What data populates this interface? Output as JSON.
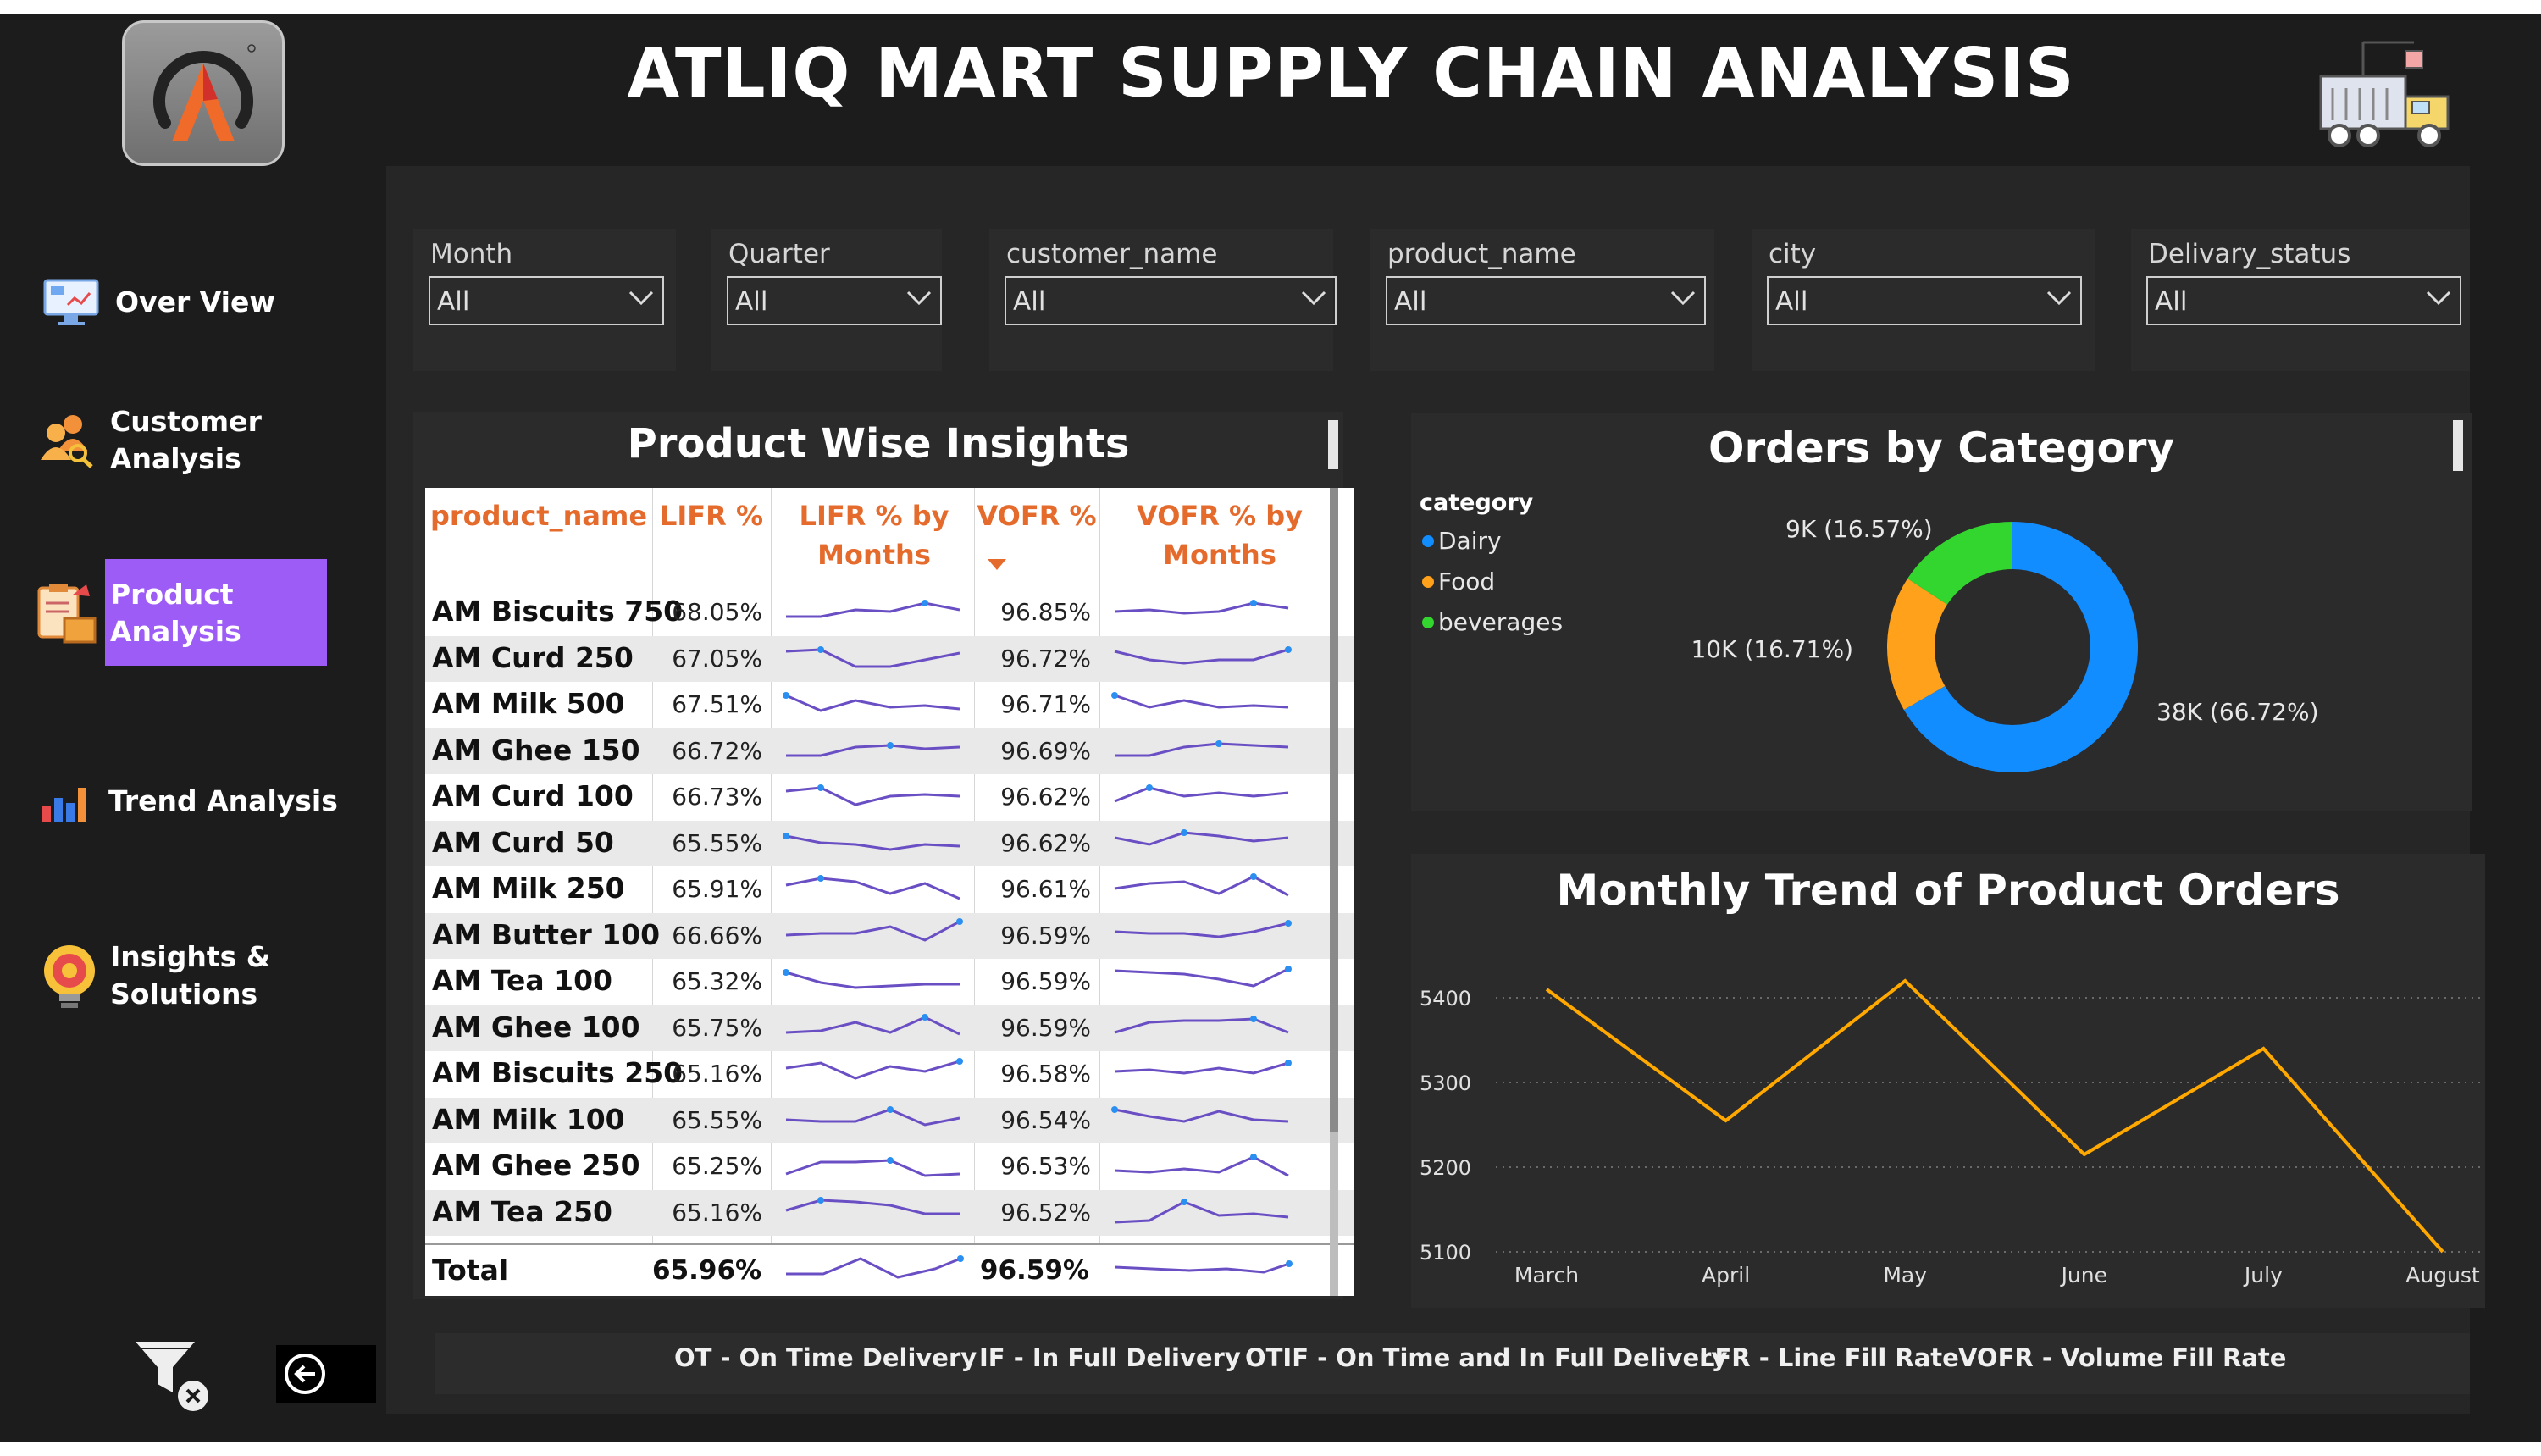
{
  "header": {
    "title": "ATLIQ MART SUPPLY CHAIN ANALYSIS"
  },
  "sidebar": {
    "items": [
      {
        "label": "Over View",
        "icon": "monitor-dashboard-icon"
      },
      {
        "label": "Customer Analysis",
        "icon": "customer-group-icon"
      },
      {
        "label": "Product Analysis",
        "icon": "product-clipboard-icon",
        "active": true
      },
      {
        "label": "Trend Analysis",
        "icon": "bar-chart-icon"
      },
      {
        "label": "Insights & Solutions",
        "icon": "gear-bulb-icon"
      }
    ],
    "active_color": "#9d5cf5"
  },
  "filters": [
    {
      "label": "Month",
      "value": "All"
    },
    {
      "label": "Quarter",
      "value": "All"
    },
    {
      "label": "customer_name",
      "value": "All"
    },
    {
      "label": "product_name",
      "value": "All"
    },
    {
      "label": "city",
      "value": "All"
    },
    {
      "label": "Delivary_status",
      "value": "All"
    }
  ],
  "product_table": {
    "title": "Product Wise Insights",
    "columns": [
      "product_name",
      "LIFR %",
      "LIFR % by Months",
      "VOFR %",
      "VOFR % by Months"
    ],
    "sort_column": "VOFR %",
    "rows": [
      {
        "name": "AM Biscuits 750",
        "lifr": "68.05%",
        "vofr": "96.85%"
      },
      {
        "name": "AM Curd 250",
        "lifr": "67.05%",
        "vofr": "96.72%"
      },
      {
        "name": "AM Milk 500",
        "lifr": "67.51%",
        "vofr": "96.71%"
      },
      {
        "name": "AM Ghee 150",
        "lifr": "66.72%",
        "vofr": "96.69%"
      },
      {
        "name": "AM Curd 100",
        "lifr": "66.73%",
        "vofr": "96.62%"
      },
      {
        "name": "AM Curd 50",
        "lifr": "65.55%",
        "vofr": "96.62%"
      },
      {
        "name": "AM Milk 250",
        "lifr": "65.91%",
        "vofr": "96.61%"
      },
      {
        "name": "AM Butter 100",
        "lifr": "66.66%",
        "vofr": "96.59%"
      },
      {
        "name": "AM Tea 100",
        "lifr": "65.32%",
        "vofr": "96.59%"
      },
      {
        "name": "AM Ghee 100",
        "lifr": "65.75%",
        "vofr": "96.59%"
      },
      {
        "name": "AM Biscuits 250",
        "lifr": "65.16%",
        "vofr": "96.58%"
      },
      {
        "name": "AM Milk 100",
        "lifr": "65.55%",
        "vofr": "96.54%"
      },
      {
        "name": "AM Ghee 250",
        "lifr": "65.25%",
        "vofr": "96.53%"
      },
      {
        "name": "AM Tea 250",
        "lifr": "65.16%",
        "vofr": "96.52%"
      }
    ],
    "total": {
      "name": "Total",
      "lifr": "65.96%",
      "vofr": "96.59%"
    },
    "header_color": "#e56b2d",
    "sparkline_color": "#6a4fc4"
  },
  "chart_data": [
    {
      "type": "pie",
      "title": "Orders by Category",
      "legend_title": "category",
      "legend_position": "top-left",
      "categories": [
        "Dairy",
        "Food",
        "beverages"
      ],
      "values": [
        38000,
        10000,
        9000
      ],
      "percents": [
        66.72,
        16.71,
        16.57
      ],
      "labels": [
        "38K (66.72%)",
        "10K (16.71%)",
        "9K (16.57%)"
      ],
      "colors": [
        "#118dff",
        "#ffa11a",
        "#32d62f"
      ]
    },
    {
      "type": "line",
      "title": "Monthly Trend of Product Orders",
      "categories": [
        "March",
        "April",
        "May",
        "June",
        "July",
        "August"
      ],
      "values": [
        5410,
        5255,
        5420,
        5215,
        5340,
        5100
      ],
      "yticks": [
        "5400",
        "5300",
        "5200",
        "5100"
      ],
      "ylim": [
        5100,
        5420
      ],
      "grid": true,
      "color": "#ffa800"
    }
  ],
  "glossary": [
    "OT - On Time Delivery",
    "IF - In Full Delivery",
    "OTIF - On Time and In Full Delivery",
    "LFR - Line Fill Rate",
    "VOFR - Volume Fill Rate"
  ]
}
